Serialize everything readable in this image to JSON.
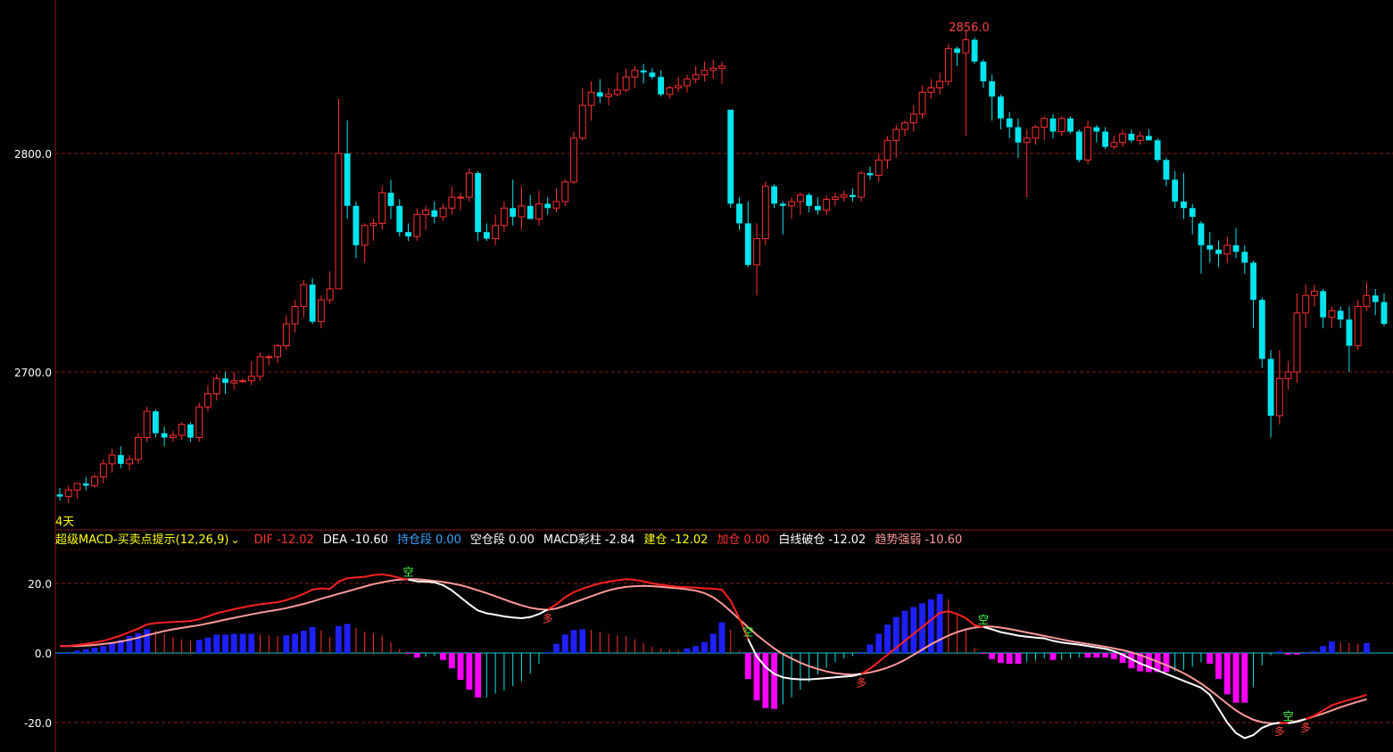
{
  "main_panel": {
    "y_ticks": [
      "2800.0",
      "2700.0"
    ],
    "max_label": "2856.0",
    "period_label": "4天"
  },
  "indicator": {
    "name": "超级MACD-买卖点提示(12,26,9)",
    "dropdown_glyph": "v",
    "items": [
      {
        "label": "DIF",
        "value": "-12.02",
        "color": "#ff3030"
      },
      {
        "label": "DEA",
        "value": "-10.60",
        "color": "#ffffff"
      },
      {
        "label": "持仓段",
        "value": "0.00",
        "color": "#36a3ff"
      },
      {
        "label": "空仓段",
        "value": "0.00",
        "color": "#ffffff"
      },
      {
        "label": "MACD彩柱",
        "value": "-2.84",
        "color": "#ffffff"
      },
      {
        "label": "建仓",
        "value": "-12.02",
        "color": "#ffff00"
      },
      {
        "label": "加仓",
        "value": "0.00",
        "color": "#ff3030"
      },
      {
        "label": "白线破仓",
        "value": "-12.02",
        "color": "#ffffff"
      },
      {
        "label": "趋势强弱",
        "value": "-10.60",
        "color": "#ff9999"
      }
    ],
    "y_ticks": [
      "20.0",
      "0.0",
      "-20.0"
    ],
    "signal_labels": {
      "long": "多",
      "short": "空"
    }
  },
  "colors": {
    "up_candle": "#ff3030",
    "down_candle": "#00e5ee",
    "grid": "#8b1a1a",
    "dif": "#ff2020",
    "dea": "#ff9999",
    "white_line": "#ffffff",
    "yellow_line": "#ffff00",
    "hist_blue": "#2020ff",
    "hist_magenta": "#ff00ff"
  },
  "chart_data": {
    "type": "candlestick",
    "series": [
      {
        "name": "DIF",
        "color": "#ff3030"
      },
      {
        "name": "DEA",
        "color": "#ffffff"
      },
      {
        "name": "MACD彩柱",
        "color": "#ff00ff"
      }
    ],
    "price_axis": {
      "ticks": [
        2800.0,
        2700.0
      ],
      "max_marked": 2856.0
    },
    "indicator_axis": {
      "ticks": [
        20.0,
        0.0,
        -20.0
      ]
    },
    "candles_ohlc": [
      [
        2644,
        2647,
        2641,
        2643
      ],
      [
        2643,
        2648,
        2640,
        2646
      ],
      [
        2646,
        2649,
        2642,
        2649
      ],
      [
        2649,
        2652,
        2646,
        2648
      ],
      [
        2648,
        2653,
        2647,
        2652
      ],
      [
        2652,
        2660,
        2649,
        2658
      ],
      [
        2658,
        2665,
        2654,
        2662
      ],
      [
        2662,
        2666,
        2656,
        2658
      ],
      [
        2658,
        2662,
        2655,
        2660
      ],
      [
        2660,
        2672,
        2658,
        2670
      ],
      [
        2670,
        2684,
        2668,
        2682
      ],
      [
        2682,
        2683,
        2670,
        2672
      ],
      [
        2672,
        2675,
        2666,
        2670
      ],
      [
        2670,
        2673,
        2668,
        2671
      ],
      [
        2671,
        2677,
        2669,
        2676
      ],
      [
        2676,
        2677,
        2668,
        2670
      ],
      [
        2670,
        2686,
        2668,
        2684
      ],
      [
        2684,
        2694,
        2682,
        2690
      ],
      [
        2690,
        2699,
        2687,
        2697
      ],
      [
        2697,
        2700,
        2690,
        2695
      ],
      [
        2695,
        2700,
        2692,
        2696
      ],
      [
        2696,
        2697,
        2695,
        2696
      ],
      [
        2696,
        2705,
        2694,
        2698
      ],
      [
        2698,
        2709,
        2696,
        2707
      ],
      [
        2707,
        2708,
        2703,
        2707
      ],
      [
        2707,
        2713,
        2704,
        2712
      ],
      [
        2712,
        2726,
        2710,
        2722
      ],
      [
        2722,
        2733,
        2718,
        2730
      ],
      [
        2730,
        2742,
        2725,
        2740
      ],
      [
        2740,
        2743,
        2722,
        2723
      ],
      [
        2723,
        2735,
        2720,
        2733
      ],
      [
        2733,
        2746,
        2731,
        2738
      ],
      [
        2738,
        2825,
        2738,
        2800
      ],
      [
        2800,
        2815,
        2770,
        2776
      ],
      [
        2776,
        2778,
        2752,
        2758
      ],
      [
        2758,
        2768,
        2750,
        2767
      ],
      [
        2767,
        2770,
        2760,
        2768
      ],
      [
        2768,
        2785,
        2765,
        2782
      ],
      [
        2782,
        2788,
        2770,
        2776
      ],
      [
        2776,
        2779,
        2762,
        2764
      ],
      [
        2764,
        2768,
        2760,
        2762
      ],
      [
        2762,
        2775,
        2760,
        2772
      ],
      [
        2772,
        2776,
        2765,
        2774
      ],
      [
        2774,
        2778,
        2768,
        2771
      ],
      [
        2771,
        2777,
        2769,
        2775
      ],
      [
        2775,
        2785,
        2772,
        2780
      ],
      [
        2780,
        2782,
        2774,
        2780
      ],
      [
        2780,
        2793,
        2778,
        2791
      ],
      [
        2791,
        2792,
        2760,
        2764
      ],
      [
        2764,
        2768,
        2760,
        2761
      ],
      [
        2761,
        2772,
        2758,
        2767
      ],
      [
        2767,
        2778,
        2764,
        2775
      ],
      [
        2775,
        2788,
        2767,
        2771
      ],
      [
        2771,
        2785,
        2765,
        2776
      ],
      [
        2776,
        2781,
        2772,
        2770
      ],
      [
        2770,
        2783,
        2767,
        2777
      ],
      [
        2777,
        2780,
        2772,
        2775
      ],
      [
        2775,
        2784,
        2773,
        2778
      ],
      [
        2778,
        2788,
        2776,
        2787
      ],
      [
        2787,
        2810,
        2786,
        2807
      ],
      [
        2807,
        2830,
        2806,
        2822
      ],
      [
        2822,
        2833,
        2815,
        2828
      ],
      [
        2828,
        2834,
        2823,
        2826
      ],
      [
        2826,
        2830,
        2822,
        2827
      ],
      [
        2827,
        2837,
        2826,
        2829
      ],
      [
        2829,
        2839,
        2828,
        2835
      ],
      [
        2835,
        2840,
        2830,
        2838
      ],
      [
        2838,
        2841,
        2832,
        2837
      ],
      [
        2837,
        2839,
        2834,
        2835
      ],
      [
        2835,
        2838,
        2826,
        2827
      ],
      [
        2827,
        2831,
        2825,
        2830
      ],
      [
        2830,
        2835,
        2828,
        2831
      ],
      [
        2831,
        2836,
        2828,
        2834
      ],
      [
        2834,
        2840,
        2832,
        2836
      ],
      [
        2836,
        2842,
        2833,
        2838
      ],
      [
        2838,
        2843,
        2834,
        2839
      ],
      [
        2839,
        2842,
        2832,
        2840
      ],
      [
        2820,
        2820,
        2775,
        2777
      ],
      [
        2777,
        2780,
        2765,
        2768
      ],
      [
        2768,
        2778,
        2748,
        2749
      ],
      [
        2749,
        2768,
        2735,
        2761
      ],
      [
        2761,
        2787,
        2758,
        2785
      ],
      [
        2785,
        2786,
        2775,
        2777
      ],
      [
        2777,
        2778,
        2763,
        2776
      ],
      [
        2776,
        2780,
        2770,
        2778
      ],
      [
        2778,
        2782,
        2772,
        2781
      ],
      [
        2781,
        2782,
        2773,
        2776
      ],
      [
        2776,
        2780,
        2772,
        2774
      ],
      [
        2774,
        2781,
        2772,
        2779
      ],
      [
        2779,
        2782,
        2776,
        2780
      ],
      [
        2780,
        2783,
        2778,
        2781
      ],
      [
        2781,
        2784,
        2778,
        2780
      ],
      [
        2780,
        2792,
        2778,
        2791
      ],
      [
        2791,
        2794,
        2788,
        2790
      ],
      [
        2790,
        2800,
        2787,
        2797
      ],
      [
        2797,
        2808,
        2793,
        2806
      ],
      [
        2806,
        2813,
        2798,
        2811
      ],
      [
        2811,
        2815,
        2808,
        2814
      ],
      [
        2814,
        2822,
        2810,
        2818
      ],
      [
        2818,
        2831,
        2816,
        2828
      ],
      [
        2828,
        2834,
        2825,
        2830
      ],
      [
        2830,
        2837,
        2827,
        2833
      ],
      [
        2833,
        2850,
        2831,
        2848
      ],
      [
        2848,
        2849,
        2840,
        2846
      ],
      [
        2846,
        2856,
        2808,
        2852
      ],
      [
        2852,
        2853,
        2841,
        2842
      ],
      [
        2842,
        2843,
        2830,
        2833
      ],
      [
        2833,
        2836,
        2815,
        2826
      ],
      [
        2826,
        2827,
        2811,
        2816
      ],
      [
        2816,
        2819,
        2807,
        2812
      ],
      [
        2812,
        2816,
        2798,
        2805
      ],
      [
        2805,
        2811,
        2780,
        2807
      ],
      [
        2807,
        2813,
        2804,
        2812
      ],
      [
        2812,
        2817,
        2806,
        2816
      ],
      [
        2816,
        2818,
        2807,
        2810
      ],
      [
        2810,
        2817,
        2808,
        2816
      ],
      [
        2816,
        2817,
        2809,
        2810
      ],
      [
        2810,
        2811,
        2796,
        2797
      ],
      [
        2797,
        2815,
        2795,
        2812
      ],
      [
        2812,
        2813,
        2805,
        2810
      ],
      [
        2810,
        2812,
        2802,
        2803
      ],
      [
        2803,
        2808,
        2802,
        2805
      ],
      [
        2805,
        2811,
        2803,
        2809
      ],
      [
        2809,
        2811,
        2805,
        2806
      ],
      [
        2806,
        2810,
        2804,
        2808
      ],
      [
        2808,
        2811,
        2806,
        2806
      ],
      [
        2806,
        2807,
        2796,
        2797
      ],
      [
        2797,
        2798,
        2785,
        2788
      ],
      [
        2788,
        2792,
        2775,
        2778
      ],
      [
        2778,
        2791,
        2770,
        2775
      ],
      [
        2775,
        2777,
        2763,
        2771
      ],
      [
        2768,
        2769,
        2745,
        2758
      ],
      [
        2758,
        2764,
        2750,
        2756
      ],
      [
        2756,
        2760,
        2748,
        2754
      ],
      [
        2754,
        2762,
        2750,
        2758
      ],
      [
        2758,
        2766,
        2752,
        2755
      ],
      [
        2755,
        2758,
        2745,
        2750
      ],
      [
        2750,
        2751,
        2720,
        2733
      ],
      [
        2733,
        2734,
        2702,
        2706
      ],
      [
        2706,
        2710,
        2670,
        2680
      ],
      [
        2680,
        2710,
        2676,
        2697
      ],
      [
        2697,
        2705,
        2692,
        2700
      ],
      [
        2700,
        2736,
        2695,
        2727
      ],
      [
        2727,
        2740,
        2720,
        2735
      ],
      [
        2735,
        2740,
        2730,
        2737
      ],
      [
        2737,
        2738,
        2720,
        2725
      ],
      [
        2725,
        2730,
        2720,
        2728
      ],
      [
        2728,
        2730,
        2720,
        2724
      ],
      [
        2724,
        2730,
        2700,
        2712
      ],
      [
        2712,
        2733,
        2710,
        2730
      ],
      [
        2730,
        2741,
        2728,
        2735
      ],
      [
        2735,
        2738,
        2726,
        2732
      ],
      [
        2732,
        2736,
        2721,
        2722
      ]
    ],
    "dif": [
      2,
      2,
      2.3,
      2.6,
      3,
      3.5,
      4.2,
      5,
      6,
      7,
      8.2,
      8.6,
      8.8,
      8.9,
      9,
      9.2,
      9.7,
      10.5,
      11.4,
      12,
      12.6,
      13.1,
      13.6,
      14,
      14.3,
      14.6,
      15.2,
      16,
      17,
      18.2,
      18.6,
      18.4,
      20.5,
      21.5,
      21.7,
      21.9,
      22.4,
      22.6,
      22.2,
      21.6,
      21.1,
      20.6,
      20.5,
      20.3,
      19.5,
      18,
      16,
      14,
      12.2,
      11.4,
      11,
      10.5,
      10.2,
      10,
      10.3,
      11.2,
      12.5,
      14,
      16,
      17.5,
      18.5,
      19.3,
      20,
      20.5,
      20.9,
      21.2,
      21,
      20.6,
      20,
      19.6,
      19.3,
      19,
      18.9,
      18.8,
      18.6,
      18.5,
      18.2,
      15,
      10,
      4,
      -1,
      -4,
      -6,
      -7,
      -7.4,
      -7.6,
      -7.6,
      -7.4,
      -7.2,
      -7,
      -6.8,
      -6.6,
      -6,
      -4.5,
      -2.5,
      -0.5,
      1.5,
      3.5,
      5.5,
      7.5,
      9.5,
      11.5,
      12,
      11.2,
      10,
      8,
      7.5,
      6.8,
      6,
      5.5,
      5,
      4.7,
      4.4,
      4.2,
      3.5,
      3,
      2.7,
      2.4,
      2,
      1.6,
      1.2,
      0.5,
      -0.5,
      -1.8,
      -3,
      -4,
      -5,
      -6,
      -7,
      -8,
      -9,
      -10,
      -12,
      -16,
      -20,
      -23,
      -24.5,
      -23.6,
      -21.5,
      -20.5,
      -20,
      -20.2,
      -19.8,
      -19,
      -18,
      -16.5,
      -15,
      -14.2,
      -13.5,
      -12.8,
      -12.02
    ],
    "dea": [
      2,
      2,
      2,
      2.1,
      2.3,
      2.6,
      2.9,
      3.3,
      3.8,
      4.4,
      5.1,
      5.7,
      6.3,
      6.8,
      7.2,
      7.6,
      8,
      8.5,
      9,
      9.6,
      10.1,
      10.6,
      11.1,
      11.6,
      12,
      12.4,
      12.9,
      13.5,
      14.1,
      14.8,
      15.6,
      16.3,
      17,
      17.7,
      18.4,
      19.1,
      19.8,
      20.3,
      20.8,
      21.1,
      21.2,
      21.2,
      21,
      20.7,
      20.4,
      20,
      19.5,
      18.8,
      18,
      17.2,
      16.3,
      15.4,
      14.5,
      13.7,
      13,
      12.6,
      12.4,
      12.8,
      13.6,
      14.5,
      15.4,
      16.3,
      17.2,
      18,
      18.6,
      19,
      19.2,
      19.3,
      19.2,
      19,
      18.8,
      18.6,
      18.3,
      17.9,
      17.2,
      16,
      14.2,
      12,
      9.7,
      7.4,
      5.2,
      3.2,
      1.3,
      -0.3,
      -1.6,
      -2.8,
      -3.8,
      -4.6,
      -5.3,
      -5.8,
      -6.1,
      -6.2,
      -6,
      -5.6,
      -5,
      -4.2,
      -3.2,
      -2,
      -0.5,
      1,
      2.5,
      3.8,
      5,
      6,
      6.8,
      7.3,
      7.6,
      7.6,
      7.3,
      6.9,
      6.4,
      5.9,
      5.4,
      4.9,
      4.4,
      3.9,
      3.4,
      3,
      2.6,
      2.2,
      1.8,
      1.3,
      0.8,
      0.2,
      -0.6,
      -1.5,
      -2.5,
      -3.5,
      -4.6,
      -5.8,
      -7.2,
      -8.8,
      -10.6,
      -12.6,
      -14.6,
      -16.5,
      -18,
      -19.2,
      -19.9,
      -20.2,
      -20.2,
      -20,
      -19.6,
      -19,
      -18.2,
      -17.4,
      -16.5,
      -15.6,
      -14.8,
      -14,
      -13.3,
      -12.6,
      -12,
      -11.2,
      -10.6
    ]
  }
}
